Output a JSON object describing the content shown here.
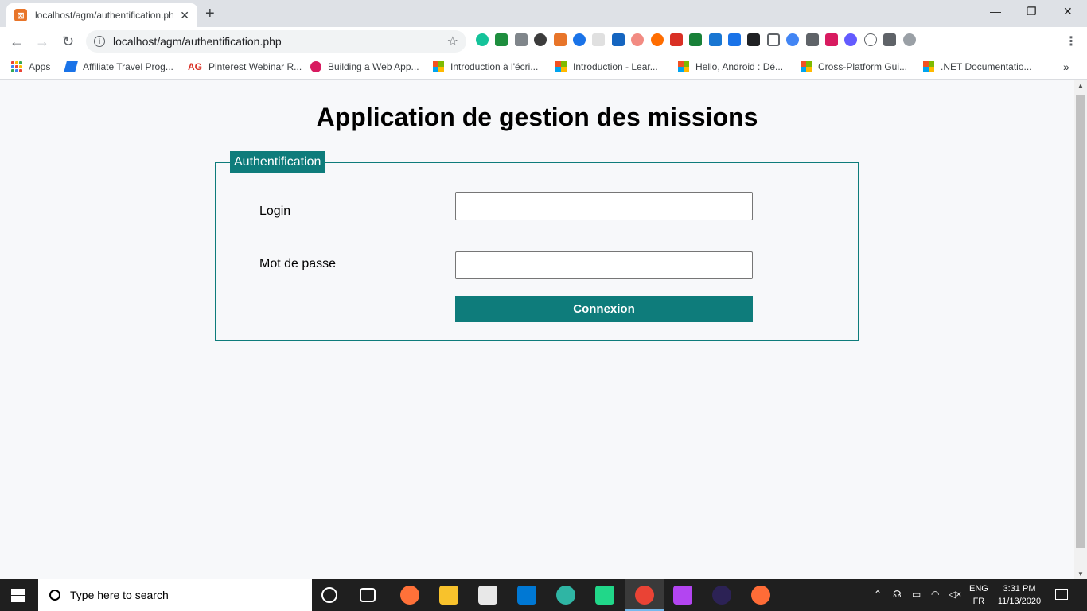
{
  "browser": {
    "tab_title": "localhost/agm/authentification.php",
    "url": "localhost/agm/authentification.php",
    "new_tab": "+",
    "close_tab": "✕",
    "window_controls": {
      "minimize": "—",
      "maximize": "❐",
      "close": "✕"
    },
    "nav": {
      "back": "←",
      "forward": "→",
      "reload": "↻"
    },
    "extensions": [
      "grammarly-icon",
      "flag-icon",
      "camera-icon",
      "k-icon",
      "off-icon",
      "shield-icon",
      "square-icon",
      "redir-icon",
      "rainbow-icon",
      "opera-icon",
      "pdf-icon",
      "s-icon",
      "new-icon",
      "puzzle-arrow-icon",
      "f-icon",
      "capture-icon",
      "owl-icon",
      "eyedropper-icon",
      "bolt-icon",
      "stripe-icon",
      "h-icon",
      "extensions-icon",
      "profile-icon"
    ],
    "bookmarks": [
      {
        "label": "Apps",
        "icon": "apps-grid-icon"
      },
      {
        "label": "Affiliate Travel Prog...",
        "icon": "travel-icon"
      },
      {
        "label": "Pinterest Webinar R...",
        "icon": "ag-icon"
      },
      {
        "label": "Building a Web App...",
        "icon": "play-icon"
      },
      {
        "label": "Introduction à l'écri...",
        "icon": "microsoft-icon"
      },
      {
        "label": "Introduction - Lear...",
        "icon": "microsoft-icon"
      },
      {
        "label": "Hello, Android : Dé...",
        "icon": "microsoft-icon"
      },
      {
        "label": "Cross-Platform Gui...",
        "icon": "microsoft-icon"
      },
      {
        "label": ".NET Documentatio...",
        "icon": "microsoft-icon"
      }
    ],
    "bookmarks_more": "»"
  },
  "page": {
    "title": "Application de gestion des missions",
    "fieldset_legend": "Authentification",
    "login_label": "Login",
    "login_value": "",
    "password_label": "Mot de passe",
    "password_value": "",
    "submit_label": "Connexion",
    "accent_color": "#0e7c7b"
  },
  "taskbar": {
    "search_placeholder": "Type here to search",
    "lang_top": "ENG",
    "lang_bottom": "FR",
    "time": "3:31 PM",
    "date": "11/13/2020",
    "apps": [
      "cortana-icon",
      "task-view-icon",
      "firefox-icon",
      "file-explorer-icon",
      "store-icon",
      "mail-icon",
      "edge-icon",
      "pycharm-icon",
      "chrome-icon",
      "phpstorm-icon",
      "eclipse-icon",
      "postman-icon"
    ]
  }
}
